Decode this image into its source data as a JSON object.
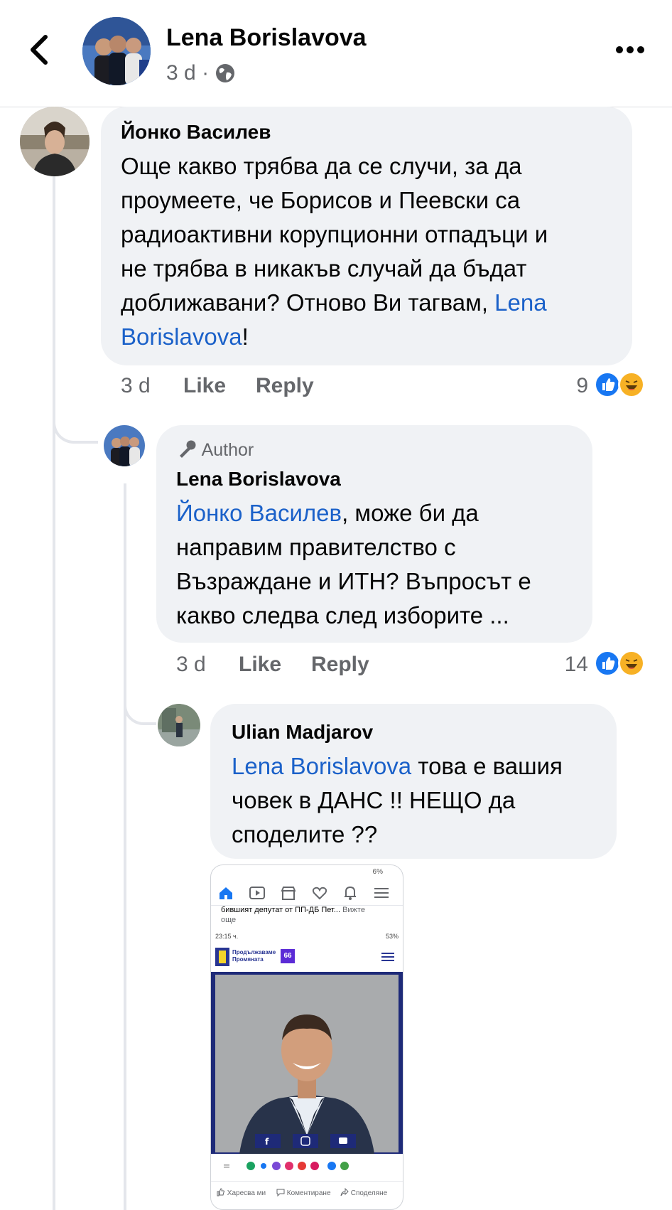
{
  "header": {
    "title": "Lena Borislavova",
    "time": "3 d",
    "separator": "·"
  },
  "comments": [
    {
      "author": "Йонко Василев",
      "text_lines": [
        "Още какво трябва да се случи, за да",
        "проумеете, че Борисов и Пеевски са",
        "радиоактивни корупционни отпадъци и",
        "не трябва в никакъв случай да бъдат"
      ],
      "line5_text": "доближавани? Отново Ви тагвам, ",
      "line5_mention": "Lena",
      "line6_mention": "Borislavova",
      "line6_rest": "!",
      "time": "3 d",
      "like_label": "Like",
      "reply_label": "Reply",
      "reaction_count": "9"
    },
    {
      "badge": "Author",
      "author": "Lena Borislavova",
      "mention": "Йонко Василев",
      "line1_rest": ", може би да",
      "text_lines": [
        "направим правителство с",
        "Възраждане и ИТН? Въпросът е",
        "какво следва след изборите ..."
      ],
      "time": "3 d",
      "like_label": "Like",
      "reply_label": "Reply",
      "reaction_count": "14"
    },
    {
      "author": "Ulian Madjarov",
      "mention": "Lena Borislavova",
      "line1_rest": " това е вашия",
      "text_lines": [
        "човек в ДАНС !! НЕЩО да",
        "споделите ??"
      ]
    }
  ],
  "attachment": {
    "status_right": "6%",
    "snippet_text": "бившият депутат от ПП-ДБ Пет...",
    "see_more": "Вижте",
    "see_more2": "още",
    "inner_time": "23:15 ч.",
    "inner_battery": "53%",
    "brand_line1": "Продължаваме",
    "brand_line2": "Промяната",
    "brand_number": "66",
    "action_like": "Харесва ми",
    "action_comment": "Коментиране",
    "action_share": "Споделяне"
  },
  "colors": {
    "link": "#1b61c9",
    "bubble": "#f0f2f5",
    "like_blue": "#1877f2",
    "haha_yellow": "#f7b125",
    "brand_blue": "#283593",
    "brand_purple": "#5b2bd6"
  }
}
